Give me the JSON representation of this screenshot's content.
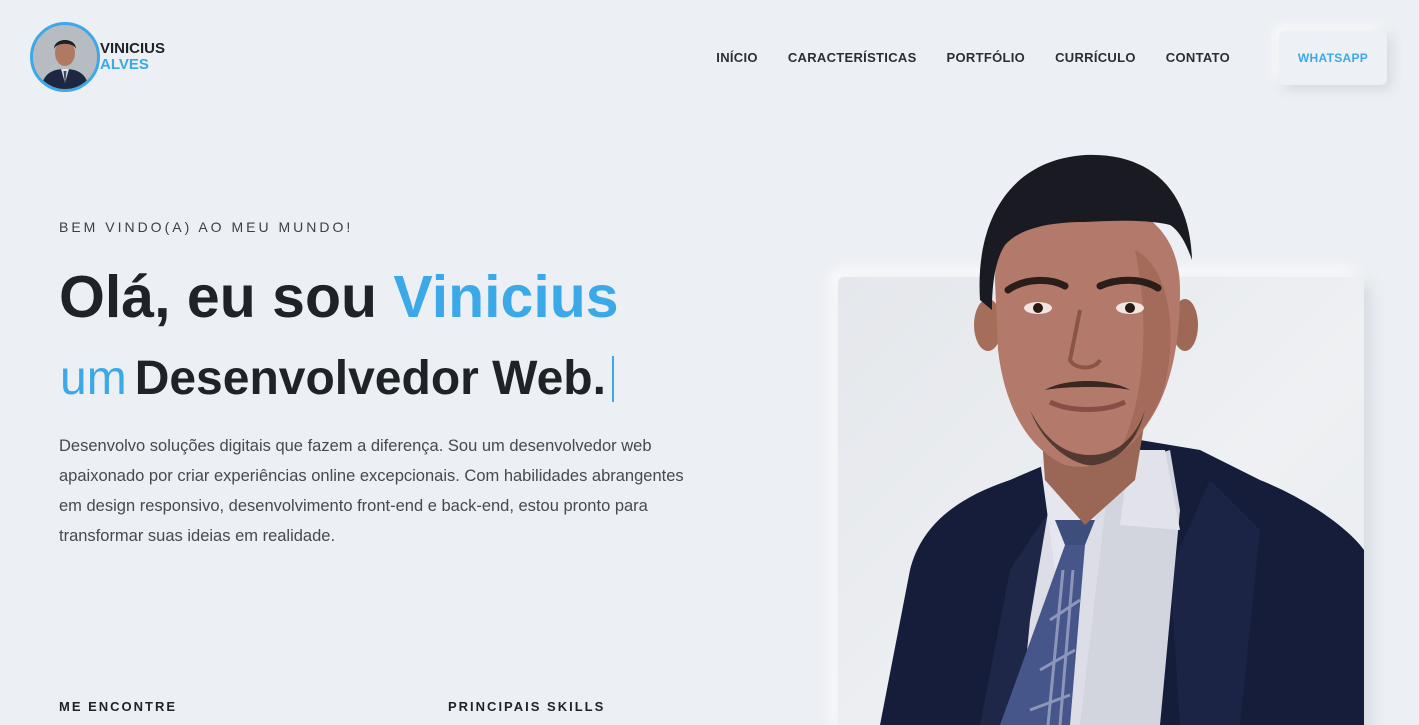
{
  "brand": {
    "first_name": "VINICIUS",
    "last_name": "ALVES"
  },
  "nav": {
    "items": [
      "INÍCIO",
      "CARACTERÍSTICAS",
      "PORTFÓLIO",
      "CURRÍCULO",
      "CONTATO"
    ],
    "cta": "WHATSAPP"
  },
  "hero": {
    "eyebrow": "BEM VINDO(A) AO MEU MUNDO!",
    "greeting": "Olá, eu sou ",
    "name": "Vinicius",
    "role_prefix": "um",
    "role": "Desenvolvedor Web.",
    "description": "Desenvolvo soluções digitais que fazem a diferença. Sou um desenvolvedor web apaixonado por criar experiências online excepcionais. Com habilidades abrangentes em design responsivo, desenvolvimento front-end e back-end, estou pronto para transformar suas ideias em realidade."
  },
  "sections": {
    "find_me": "ME ENCONTRE",
    "skills": "PRINCIPAIS SKILLS"
  },
  "colors": {
    "accent": "#3ba9e8",
    "background": "#eceff3",
    "text": "#1f2226"
  }
}
